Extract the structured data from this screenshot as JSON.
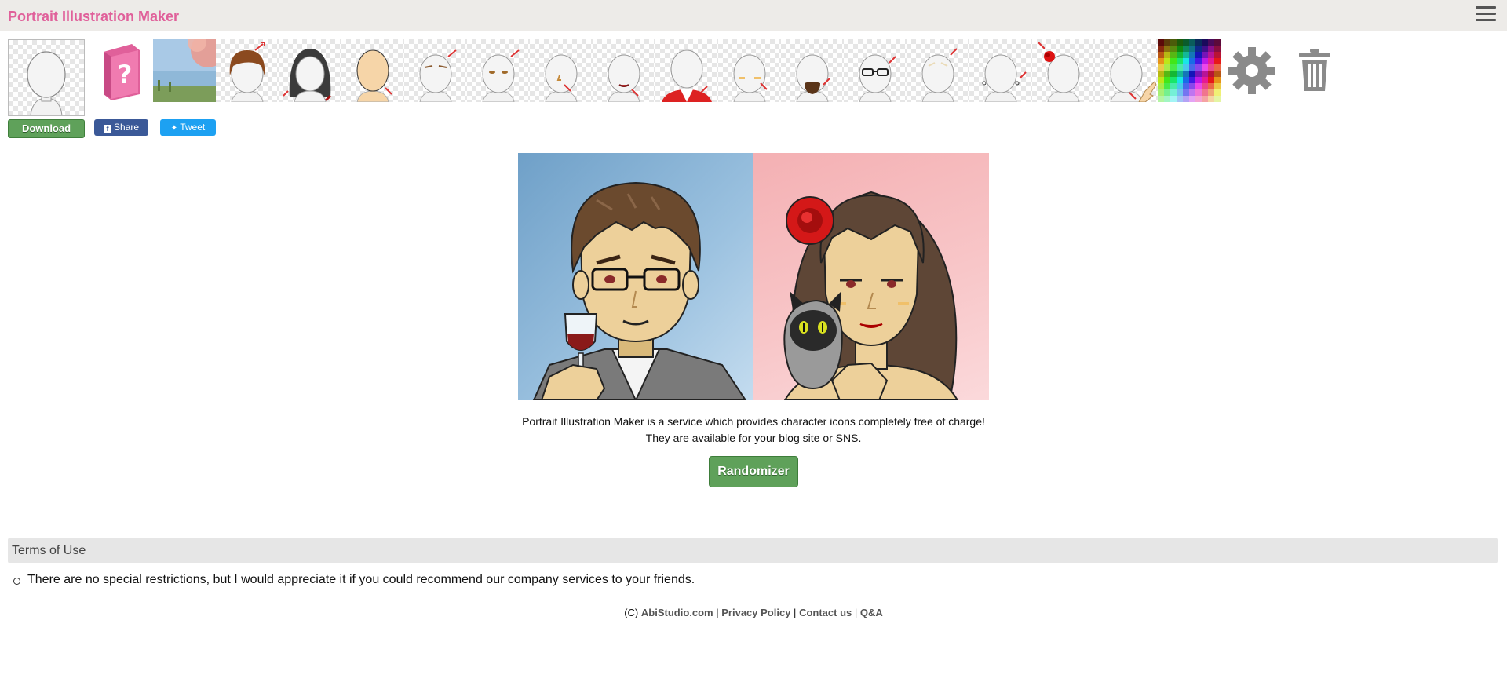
{
  "header": {
    "title": "Portrait Illustration Maker"
  },
  "toolbar": {
    "download_label": "Download",
    "share_label": "Share",
    "tweet_label": "Tweet",
    "tools": [
      "help-book-icon",
      "background",
      "hair-front",
      "hair-back",
      "face-outline",
      "eyebrows",
      "eyes",
      "nose",
      "mouth",
      "clothes",
      "cheeks",
      "beard",
      "glasses",
      "face-accessory",
      "earrings",
      "hair-accessory",
      "hand-item",
      "color-palette",
      "settings",
      "trash"
    ]
  },
  "main": {
    "description_line1": "Portrait Illustration Maker is a service which provides character icons completely free of charge!",
    "description_line2": "They are available for your blog site or SNS.",
    "randomizer_label": "Randomizer"
  },
  "terms": {
    "heading": "Terms of Use",
    "item": "There are no special restrictions, but I would appreciate it if you could recommend our company services to your friends."
  },
  "footer": {
    "copyright": "(C)",
    "site": "AbiStudio.com",
    "privacy": "Privacy Policy",
    "contact": "Contact us",
    "qa": "Q&A"
  },
  "colors": {
    "title_pink": "#e0609a",
    "download_green": "#5fa15a",
    "facebook_blue": "#3b5998",
    "twitter_blue": "#1da1f2"
  }
}
